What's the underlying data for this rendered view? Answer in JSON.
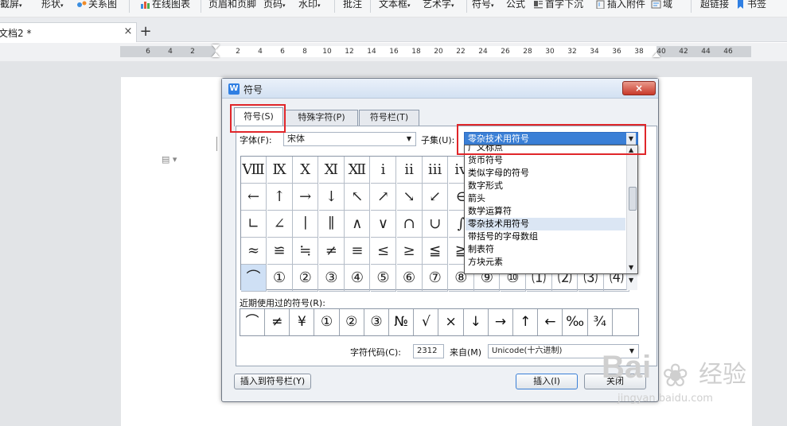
{
  "toolbar": {
    "items": [
      {
        "label": "截屏",
        "icon": "screenshot-icon"
      },
      {
        "label": "形状",
        "icon": "shapes-icon"
      },
      {
        "label": "关系图",
        "icon": "relation-chart-icon"
      },
      {
        "label": "在线图表",
        "icon": "online-chart-icon"
      },
      {
        "label": "页眉和页脚",
        "icon": "header-footer-icon"
      },
      {
        "label": "页码",
        "icon": "page-number-icon"
      },
      {
        "label": "水印",
        "icon": "watermark-icon"
      },
      {
        "label": "批注",
        "icon": "comment-icon"
      },
      {
        "label": "文本框",
        "icon": "textbox-icon"
      },
      {
        "label": "艺术字",
        "icon": "wordart-icon"
      },
      {
        "label": "符号",
        "icon": "symbol-icon"
      },
      {
        "label": "公式",
        "icon": "formula-icon"
      },
      {
        "label": "首字下沉",
        "icon": "dropcap-icon"
      },
      {
        "label": "插入附件",
        "icon": "attachment-icon"
      },
      {
        "label": "域",
        "icon": "field-icon"
      },
      {
        "label": "超链接",
        "icon": "hyperlink-icon"
      },
      {
        "label": "书签",
        "icon": "bookmark-icon"
      }
    ]
  },
  "document_tab": {
    "title": "文档2 *",
    "close": "×",
    "add": "+"
  },
  "ruler": {
    "numbers": [
      "6",
      "4",
      "2",
      "2",
      "4",
      "6",
      "8",
      "10",
      "12",
      "14",
      "16",
      "18",
      "20",
      "22",
      "24",
      "26",
      "28",
      "30",
      "32",
      "34",
      "36",
      "38",
      "40",
      "42",
      "44",
      "46"
    ]
  },
  "dialog": {
    "title": "符号",
    "close": "×",
    "tabs": [
      "符号(S)",
      "特殊字符(P)",
      "符号栏(T)"
    ],
    "font_label": "字体(F):",
    "font_value": "宋体",
    "subset_label": "子集(U):",
    "subset_value": "零杂技术用符号",
    "subset_options": [
      "广义标点",
      "货币符号",
      "类似字母的符号",
      "数字形式",
      "箭头",
      "数学运算符",
      "零杂技术用符号",
      "带括号的字母数组",
      "制表符",
      "方块元素"
    ],
    "subset_selected_index": 6,
    "symbols": [
      [
        "Ⅷ",
        "Ⅸ",
        "Ⅹ",
        "Ⅺ",
        "Ⅻ",
        "ⅰ",
        "ⅱ",
        "ⅲ",
        "ⅳ",
        "",
        "",
        "",
        "",
        "",
        ""
      ],
      [
        "←",
        "↑",
        "→",
        "↓",
        "↖",
        "↗",
        "↘",
        "↙",
        "∈",
        "",
        "",
        "",
        "",
        "",
        ""
      ],
      [
        "∟",
        "∠",
        "∣",
        "∥",
        "∧",
        "∨",
        "∩",
        "∪",
        "∫",
        "",
        "",
        "",
        "",
        "",
        ""
      ],
      [
        "≈",
        "≌",
        "≒",
        "≠",
        "≡",
        "≤",
        "≥",
        "≦",
        "≧",
        "",
        "",
        "",
        "",
        "",
        ""
      ],
      [
        "⌒",
        "①",
        "②",
        "③",
        "④",
        "⑤",
        "⑥",
        "⑦",
        "⑧",
        "⑨",
        "⑩",
        "⑴",
        "⑵",
        "⑶",
        "⑷"
      ]
    ],
    "recent_label": "近期使用过的符号(R):",
    "recent_symbols": [
      "⌒",
      "≠",
      "¥",
      "①",
      "②",
      "③",
      "№",
      "√",
      "×",
      "↓",
      "→",
      "↑",
      "←",
      "‰",
      "¾"
    ],
    "char_code_label": "字符代码(C):",
    "char_code_value": "2312",
    "from_label": "来自(M)",
    "from_value": "Unicode(十六进制)",
    "insert_to_bar_button": "插入到符号栏(Y)",
    "insert_button": "插入(I)",
    "close_button": "关闭"
  },
  "watermark": {
    "brand": "Bai",
    "brand2": "经验",
    "url": "jingyan.baidu.com"
  },
  "colors": {
    "accent": "#3a7fd6",
    "highlight": "#e0262a",
    "dialog_bg": "#eef1f5"
  }
}
